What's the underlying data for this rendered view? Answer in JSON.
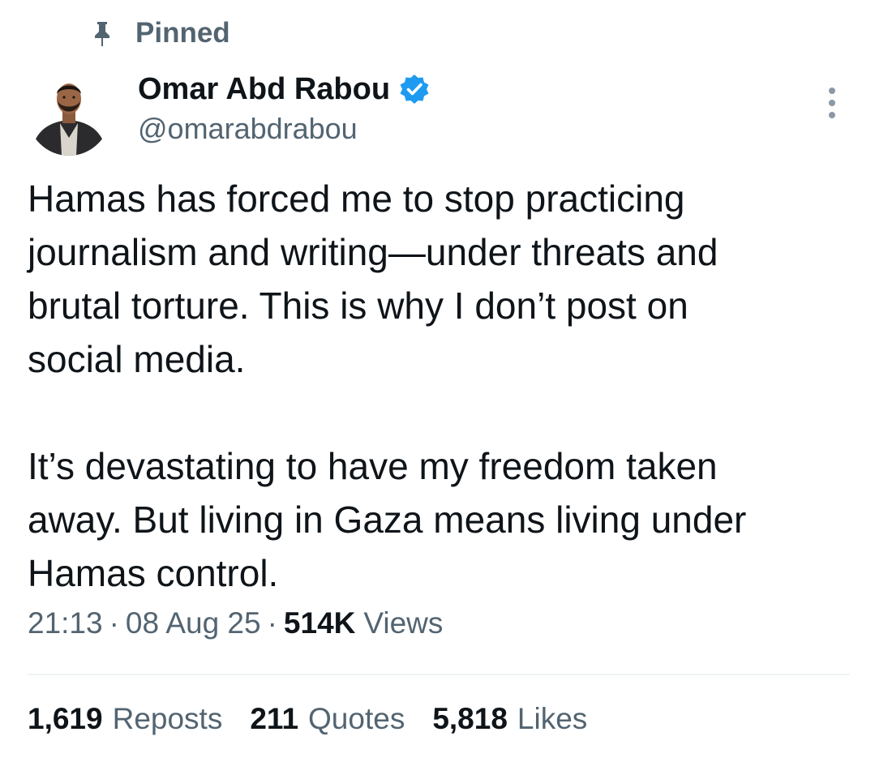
{
  "pinned": {
    "label": "Pinned",
    "icon": "pin-icon"
  },
  "author": {
    "name": "Omar Abd Rabou",
    "handle": "@omarabdrabou",
    "verified_icon": "verified-badge-icon",
    "verified_color": "#1d9bf0"
  },
  "more_button_icon": "more-vertical-icon",
  "tweet": {
    "paragraph_1": [
      "Hamas has forced me to stop practicing",
      "journalism and writing—under threats and",
      "brutal torture. This is why I don’t post on",
      "social media."
    ],
    "paragraph_2": [
      "It’s devastating to have my freedom taken",
      "away. But living in Gaza means living under",
      "Hamas control."
    ]
  },
  "meta": {
    "time": "21:13",
    "separator": "·",
    "date": "08 Aug 25",
    "views_count": "514K",
    "views_label": "Views"
  },
  "stats": {
    "reposts": {
      "count": "1,619",
      "label": "Reposts"
    },
    "quotes": {
      "count": "211",
      "label": "Quotes"
    },
    "likes": {
      "count": "5,818",
      "label": "Likes"
    }
  },
  "colors": {
    "text_primary": "#0f1419",
    "text_secondary": "#536471",
    "divider": "#eff3f4"
  }
}
